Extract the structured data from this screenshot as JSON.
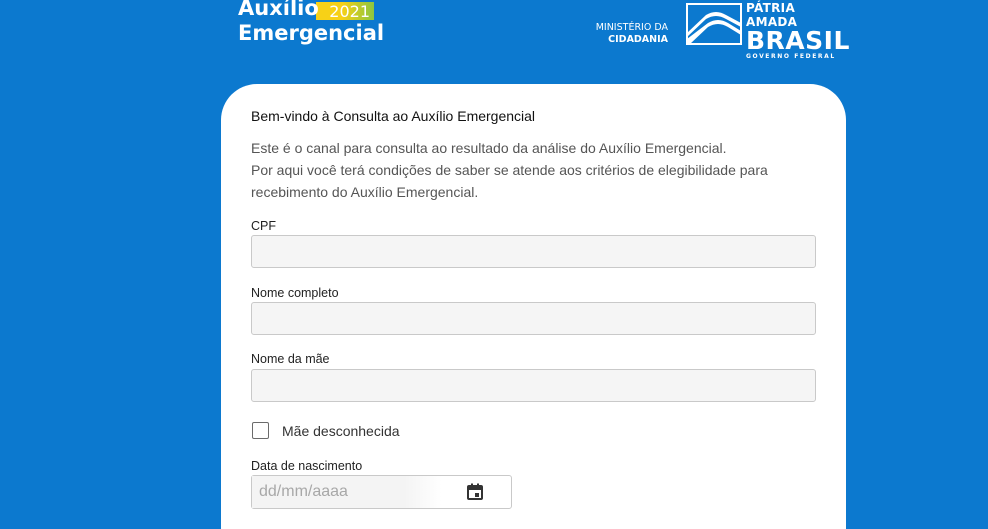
{
  "header": {
    "brand": {
      "line1": "Auxílio",
      "line2": "Emergencial",
      "year": "2021"
    },
    "ministry": {
      "line1": "MINISTÉRIO DA",
      "line2": "CIDADANIA"
    },
    "government": {
      "line1": "PÁTRIA AMADA",
      "line2": "BRASIL",
      "line3": "GOVERNO FEDERAL"
    }
  },
  "form": {
    "title": "Bem-vindo à Consulta ao Auxílio Emergencial",
    "description": [
      "Este é o canal para consulta ao resultado da análise do Auxílio Emergencial.",
      "Por aqui você terá condições de saber se atende aos critérios de elegibilidade para",
      "recebimento do Auxílio Emergencial."
    ],
    "cpf": {
      "label": "CPF",
      "value": ""
    },
    "full_name": {
      "label": "Nome completo",
      "value": ""
    },
    "mother_name": {
      "label": "Nome da mãe",
      "value": ""
    },
    "mother_unknown": {
      "label": "Mãe desconhecida",
      "checked": false
    },
    "birth_date": {
      "label": "Data de nascimento",
      "placeholder": "dd/mm/aaaa",
      "icon": "calendar-icon"
    }
  },
  "colors": {
    "background": "#0c79cf",
    "card": "#ffffff",
    "input_fill": "#f5f5f5",
    "brand_yellow": "#f7d117",
    "brand_green": "#8cc63f"
  }
}
